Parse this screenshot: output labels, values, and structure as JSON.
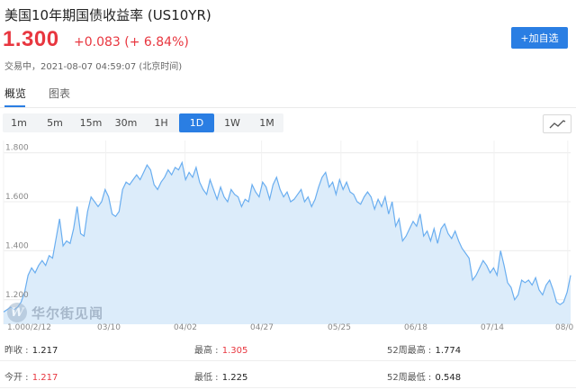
{
  "header": {
    "title": "美国10年期国债收益率 (US10YR)",
    "price": "1.300",
    "change": "+0.083 (+ 6.84%)",
    "status": "交易中，2021-08-07 04:59:07 (北京时间)",
    "add_button": "+加自选"
  },
  "tabs": [
    {
      "label": "概览",
      "active": true
    },
    {
      "label": "图表",
      "active": false
    }
  ],
  "periods": [
    {
      "label": "1m"
    },
    {
      "label": "5m"
    },
    {
      "label": "15m"
    },
    {
      "label": "30m"
    },
    {
      "label": "1H"
    },
    {
      "label": "1D",
      "active": true
    },
    {
      "label": "1W"
    },
    {
      "label": "1M"
    }
  ],
  "chart_type_icon": "line-chart-icon",
  "watermark": {
    "logo_letter": "W",
    "text": "华尔街见闻"
  },
  "colors": {
    "accent": "#2a7ee3",
    "up": "#e8363f",
    "area": "#dcecfa",
    "line": "#6aaef0"
  },
  "chart_data": {
    "type": "area",
    "y_ticks": [
      "1.800",
      "1.600",
      "1.400",
      "1.200"
    ],
    "x_ticks": [
      "1.000/2/12",
      "03/10",
      "04/02",
      "04/27",
      "05/25",
      "06/18",
      "07/14",
      "08/0"
    ],
    "ylim": [
      1.1,
      1.85
    ],
    "grid": true,
    "values": [
      1.15,
      1.16,
      1.17,
      1.16,
      1.17,
      1.19,
      1.23,
      1.3,
      1.33,
      1.31,
      1.34,
      1.36,
      1.34,
      1.38,
      1.37,
      1.45,
      1.53,
      1.42,
      1.44,
      1.43,
      1.49,
      1.58,
      1.47,
      1.46,
      1.56,
      1.62,
      1.6,
      1.58,
      1.6,
      1.65,
      1.62,
      1.55,
      1.54,
      1.56,
      1.65,
      1.68,
      1.67,
      1.69,
      1.71,
      1.69,
      1.72,
      1.75,
      1.73,
      1.67,
      1.65,
      1.68,
      1.7,
      1.73,
      1.71,
      1.74,
      1.73,
      1.76,
      1.69,
      1.72,
      1.7,
      1.74,
      1.68,
      1.65,
      1.63,
      1.69,
      1.65,
      1.61,
      1.66,
      1.62,
      1.6,
      1.65,
      1.63,
      1.62,
      1.58,
      1.61,
      1.6,
      1.67,
      1.64,
      1.62,
      1.68,
      1.66,
      1.61,
      1.67,
      1.7,
      1.65,
      1.62,
      1.64,
      1.6,
      1.61,
      1.63,
      1.65,
      1.6,
      1.62,
      1.58,
      1.61,
      1.66,
      1.7,
      1.72,
      1.66,
      1.68,
      1.63,
      1.69,
      1.65,
      1.68,
      1.64,
      1.63,
      1.6,
      1.59,
      1.62,
      1.64,
      1.62,
      1.57,
      1.61,
      1.58,
      1.62,
      1.55,
      1.6,
      1.5,
      1.53,
      1.44,
      1.46,
      1.49,
      1.52,
      1.5,
      1.55,
      1.46,
      1.48,
      1.44,
      1.49,
      1.43,
      1.49,
      1.51,
      1.47,
      1.45,
      1.48,
      1.44,
      1.41,
      1.39,
      1.37,
      1.28,
      1.3,
      1.33,
      1.36,
      1.34,
      1.31,
      1.33,
      1.3,
      1.4,
      1.34,
      1.27,
      1.25,
      1.2,
      1.22,
      1.28,
      1.27,
      1.28,
      1.26,
      1.29,
      1.24,
      1.22,
      1.26,
      1.28,
      1.24,
      1.19,
      1.18,
      1.19,
      1.23,
      1.3
    ]
  },
  "stats": [
    [
      {
        "label": "昨收 :",
        "value": "1.217",
        "color": "default"
      },
      {
        "label": "最高 :",
        "value": "1.305",
        "color": "red"
      },
      {
        "label": "52周最高 :",
        "value": "1.774",
        "color": "default"
      }
    ],
    [
      {
        "label": "今开 :",
        "value": "1.217",
        "color": "red"
      },
      {
        "label": "最低 :",
        "value": "1.225",
        "color": "default"
      },
      {
        "label": "52周最低 :",
        "value": "0.548",
        "color": "default"
      }
    ]
  ]
}
